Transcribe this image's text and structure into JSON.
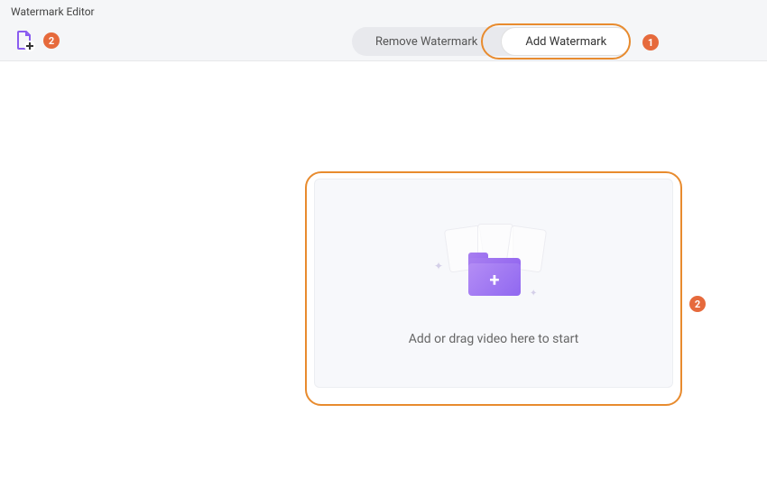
{
  "header": {
    "title": "Watermark Editor",
    "tabs": {
      "remove": "Remove Watermark",
      "add": "Add Watermark"
    },
    "icons": {
      "add_file": "file-add-icon"
    }
  },
  "annotations": {
    "badge1": "1",
    "badge2_top": "2",
    "badge2_side": "2"
  },
  "dropzone": {
    "text": "Add or drag video here to start"
  }
}
